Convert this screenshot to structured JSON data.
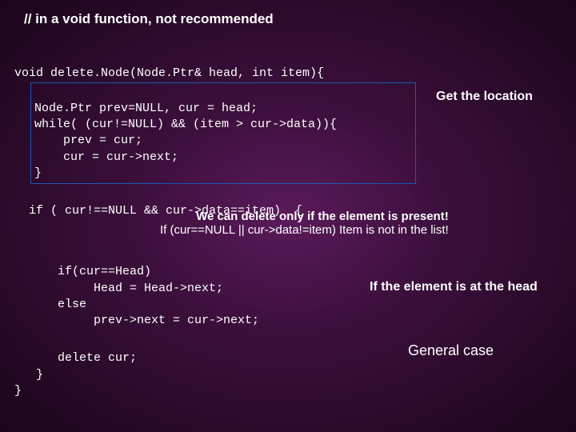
{
  "title": "// in a void function, not recommended",
  "code": {
    "sig": "void delete.Node(Node.Ptr& head, int item){",
    "box1_l1": "Node.Ptr prev=NULL, cur = head;",
    "box1_l2": "while( (cur!=NULL) && (item > cur->data)){",
    "box1_l3": "    prev = cur;",
    "box1_l4": "    cur = cur->next;",
    "box1_l5": "}",
    "ifline": "  if ( cur!==NULL && cur->data==item)  {",
    "ifhead1": "      if(cur==Head)",
    "ifhead2": "           Head = Head->next;",
    "else1": "      else",
    "else2": "           prev->next = cur->next;",
    "del": "      delete cur;",
    "close1": "   }",
    "close2": "}"
  },
  "labels": {
    "getloc": "Get the location",
    "ann_title": "We can delete only if the element is present!",
    "ann_sub": "If (cur==NULL || cur->data!=item) Item is not in the list!",
    "athead": "If the element is at the head",
    "general": "General case"
  }
}
